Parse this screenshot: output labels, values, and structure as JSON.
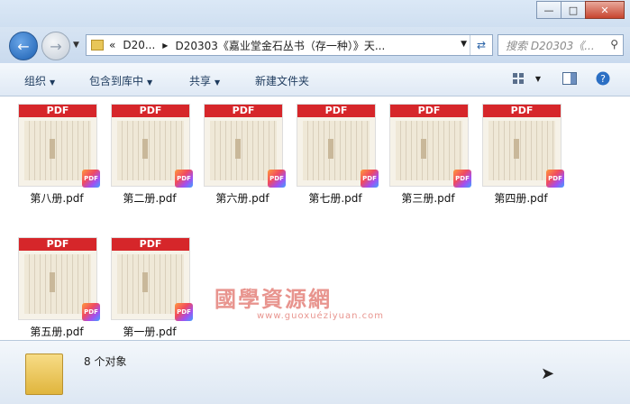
{
  "window": {
    "minimize": "—",
    "maximize": "□",
    "close": "✕"
  },
  "address": {
    "prefix": "«",
    "crumb1": "D20...",
    "crumb2": "D20303《嘉业堂金石丛书（存一种）》天..."
  },
  "search": {
    "placeholder": "搜索 D20303《..."
  },
  "toolbar": {
    "organize": "组织",
    "include_library": "包含到库中",
    "share": "共享",
    "new_folder": "新建文件夹"
  },
  "files": [
    {
      "name": "第八册.pdf",
      "banner": "PDF"
    },
    {
      "name": "第二册.pdf",
      "banner": "PDF"
    },
    {
      "name": "第六册.pdf",
      "banner": "PDF"
    },
    {
      "name": "第七册.pdf",
      "banner": "PDF"
    },
    {
      "name": "第三册.pdf",
      "banner": "PDF"
    },
    {
      "name": "第四册.pdf",
      "banner": "PDF"
    },
    {
      "name": "第五册.pdf",
      "banner": "PDF"
    },
    {
      "name": "第一册.pdf",
      "banner": "PDF"
    }
  ],
  "badge_text": "PDF",
  "watermark": {
    "text": "國學資源網",
    "url": "www.guoxuéziyuan.com"
  },
  "status": {
    "item_count": "8 个对象"
  }
}
